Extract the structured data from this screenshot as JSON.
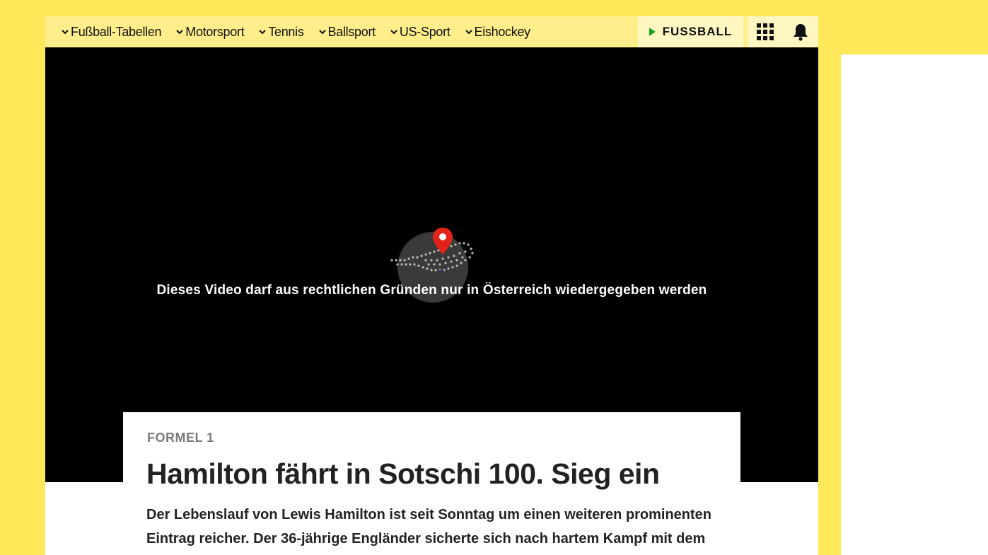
{
  "nav": {
    "items": [
      {
        "label": "Fußball-Tabellen"
      },
      {
        "label": "Motorsport"
      },
      {
        "label": "Tennis"
      },
      {
        "label": "Ballsport"
      },
      {
        "label": "US-Sport"
      },
      {
        "label": "Eishockey"
      }
    ],
    "sport_button_label": "FUSSBALL",
    "icons": [
      "apps-grid-icon",
      "bell-icon"
    ]
  },
  "video": {
    "geo_message": "Dieses Video darf aus rechtlichen Gründen nur in Österreich wiedergegeben werden",
    "icon": "map-pin-icon"
  },
  "article": {
    "kicker": "FORMEL 1",
    "headline": "Hamilton fährt in Sotschi 100. Sieg ein",
    "lead": "Der Lebenslauf von Lewis Hamilton ist seit Sonntag um einen weiteren prominenten Eintrag reicher. Der 36-jährige Engländer sicherte sich nach hartem Kampf mit dem"
  },
  "colors": {
    "background": "#ffe75a",
    "nav_background": "#ffee8a",
    "accent_play": "#1aa521",
    "pin_red": "#e2231a"
  }
}
